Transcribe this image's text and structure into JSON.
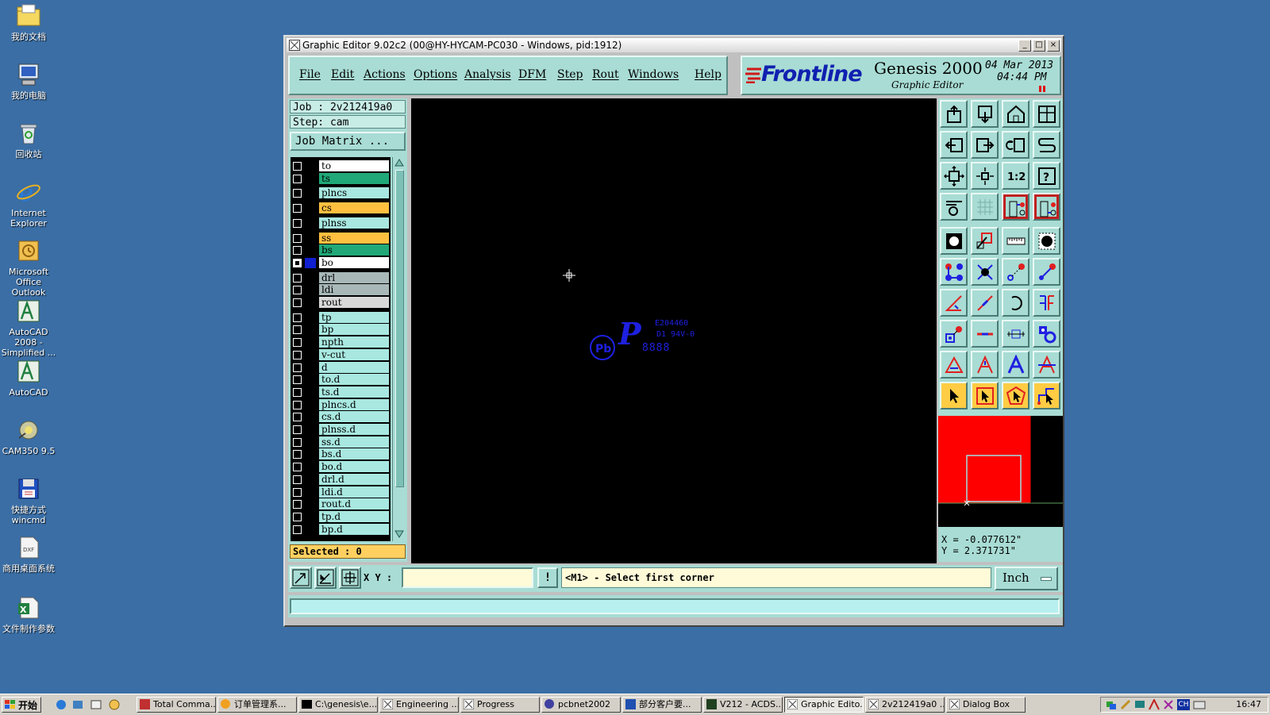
{
  "desktop": {
    "icons": [
      {
        "label": "我的文档"
      },
      {
        "label": "我的电脑"
      },
      {
        "label": "回收站"
      },
      {
        "label": "Internet Explorer"
      },
      {
        "label": "Microsoft Office Outlook"
      },
      {
        "label": "AutoCAD 2008 - Simplified ..."
      },
      {
        "label": "AutoCAD"
      },
      {
        "label": "CAM350 9.5"
      },
      {
        "label": "快捷方式 wincmd"
      },
      {
        "label": "商用桌面系统"
      },
      {
        "label": "文件制作参数"
      }
    ]
  },
  "window": {
    "title": "Graphic Editor 9.02c2 (00@HY-HYCAM-PC030 - Windows, pid:1912)",
    "minimize": "_",
    "maximize": "□",
    "close": "×"
  },
  "menu": {
    "file": "File",
    "edit": "Edit",
    "actions": "Actions",
    "options": "Options",
    "analysis": "Analysis",
    "dfm": "DFM",
    "step": "Step",
    "rout": "Rout",
    "windows": "Windows",
    "help": "Help"
  },
  "brand": {
    "logo": "Frontline",
    "product": "Genesis 2000",
    "subtitle": "Graphic Editor",
    "date": "04 Mar 2013",
    "time": "04:44 PM"
  },
  "job": {
    "job_line": "Job : 2v212419a0",
    "step_line": "Step: cam",
    "matrix_button": "Job Matrix ...",
    "selected": "Selected : 0"
  },
  "layers": [
    {
      "name": "to",
      "color": "#ffffff",
      "checked": false
    },
    {
      "name": "ts",
      "color": "#20a878",
      "checked": false
    },
    {
      "name": "plncs",
      "color": "#a8e8e0",
      "checked": false
    },
    {
      "name": "cs",
      "color": "#ffc040",
      "checked": false
    },
    {
      "name": "plnss",
      "color": "#a8e8e0",
      "checked": false
    },
    {
      "name": "ss",
      "color": "#ffc040",
      "checked": false
    },
    {
      "name": "bs",
      "color": "#20a878",
      "checked": false
    },
    {
      "name": "bo",
      "color": "#ffffff",
      "checked": true
    },
    {
      "name": "drl",
      "color": "#a8b8b8",
      "checked": false
    },
    {
      "name": "ldi",
      "color": "#a8b8b8",
      "checked": false
    },
    {
      "name": "rout",
      "color": "#d8d8d8",
      "checked": false
    },
    {
      "name": "tp",
      "color": "#a8e8e0",
      "checked": false
    },
    {
      "name": "bp",
      "color": "#a8e8e0",
      "checked": false
    },
    {
      "name": "npth",
      "color": "#a8e8e0",
      "checked": false
    },
    {
      "name": "v-cut",
      "color": "#a8e8e0",
      "checked": false
    },
    {
      "name": "d",
      "color": "#a8e8e0",
      "checked": false
    },
    {
      "name": "to.d",
      "color": "#a8e8e0",
      "checked": false
    },
    {
      "name": "ts.d",
      "color": "#a8e8e0",
      "checked": false
    },
    {
      "name": "plncs.d",
      "color": "#a8e8e0",
      "checked": false
    },
    {
      "name": "cs.d",
      "color": "#a8e8e0",
      "checked": false
    },
    {
      "name": "plnss.d",
      "color": "#a8e8e0",
      "checked": false
    },
    {
      "name": "ss.d",
      "color": "#a8e8e0",
      "checked": false
    },
    {
      "name": "bs.d",
      "color": "#a8e8e0",
      "checked": false
    },
    {
      "name": "bo.d",
      "color": "#a8e8e0",
      "checked": false
    },
    {
      "name": "drl.d",
      "color": "#a8e8e0",
      "checked": false
    },
    {
      "name": "ldi.d",
      "color": "#a8e8e0",
      "checked": false
    },
    {
      "name": "rout.d",
      "color": "#a8e8e0",
      "checked": false
    },
    {
      "name": "tp.d",
      "color": "#a8e8e0",
      "checked": false
    },
    {
      "name": "bp.d",
      "color": "#a8e8e0",
      "checked": false
    }
  ],
  "canvas": {
    "marking_code": "E204460",
    "marking_rating": "D1 94V-0",
    "marking_digits": "8888",
    "marking_pb": "Pb",
    "marking_glyph": "P",
    "cursor_icon": "crosshair-icon"
  },
  "coords": {
    "x": "X = -0.077612\"",
    "y": "Y = 2.371731\""
  },
  "command": {
    "xy_label": "X Y :",
    "xy_value": "",
    "warn": "!",
    "prompt": "<M1> - Select first corner",
    "units": "Inch"
  },
  "taskbar": {
    "start": "开始",
    "tasks": [
      {
        "label": "Total Comma...",
        "active": false
      },
      {
        "label": "订单管理系...",
        "active": false
      },
      {
        "label": "C:\\genesis\\e...",
        "active": false
      },
      {
        "label": "Engineering ...",
        "active": false
      },
      {
        "label": "Progress",
        "active": false
      },
      {
        "label": "pcbnet2002",
        "active": false
      },
      {
        "label": "部分客户要...",
        "active": false
      },
      {
        "label": "V212 - ACDS...",
        "active": false
      },
      {
        "label": "Graphic Edito...",
        "active": true
      },
      {
        "label": "2v212419a0 ...",
        "active": false
      },
      {
        "label": "Dialog Box",
        "active": false
      }
    ],
    "tray_ch": "CH",
    "clock": "16:47"
  },
  "colors": {
    "accent": "#a8dcd4",
    "canvas_bg": "#000000",
    "feature_blue": "#1e20e0",
    "minimap_red": "#ff0000",
    "desktop_bg": "#3a6ea5"
  }
}
